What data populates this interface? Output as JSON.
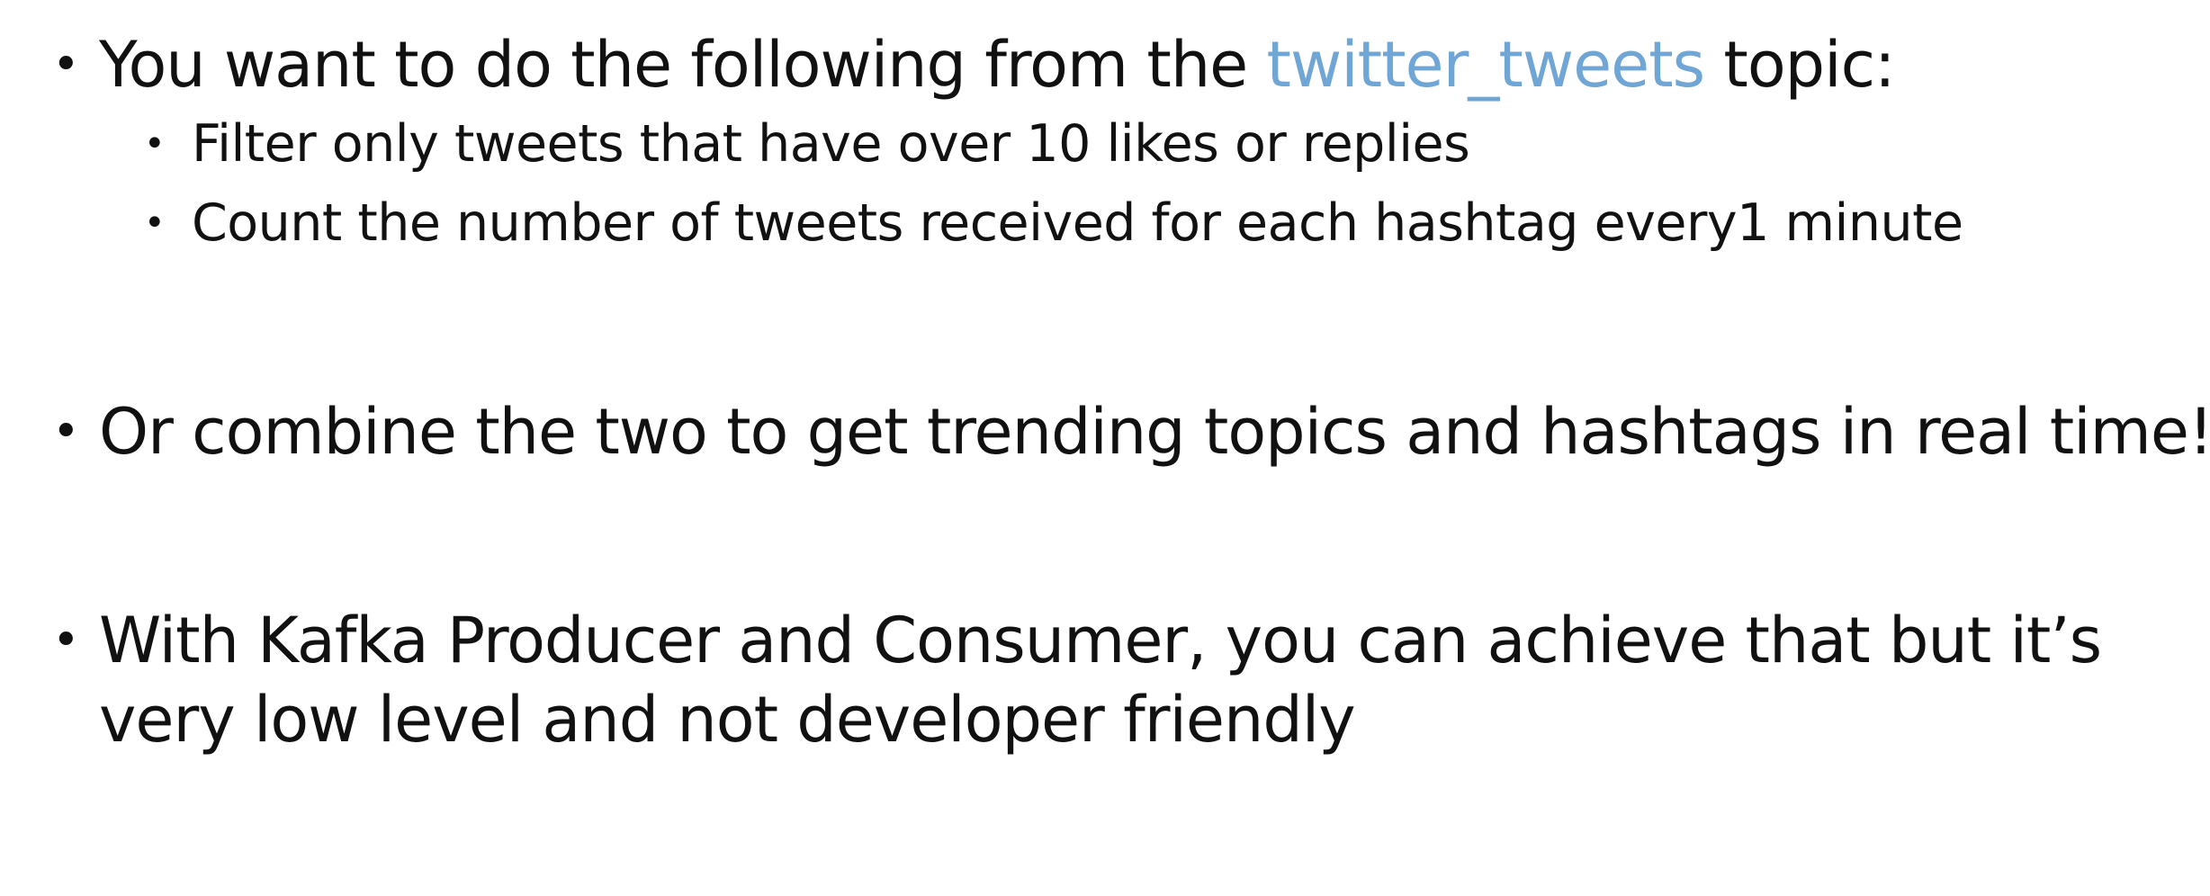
{
  "bullets": [
    {
      "pre": "You want to do the following from the ",
      "highlight": "twitter_tweets",
      "post": " topic:",
      "highlight_color": "#6fa6d6",
      "sub": [
        "Filter only tweets that have over 10 likes or replies",
        "Count the number of tweets received for each hashtag every1 minute"
      ]
    },
    {
      "text": "Or combine the two to get trending topics and hashtags in real time!"
    },
    {
      "line1": "With Kafka Producer and Consumer, you can achieve that but it’s",
      "line2": "very low level and not developer friendly"
    }
  ]
}
